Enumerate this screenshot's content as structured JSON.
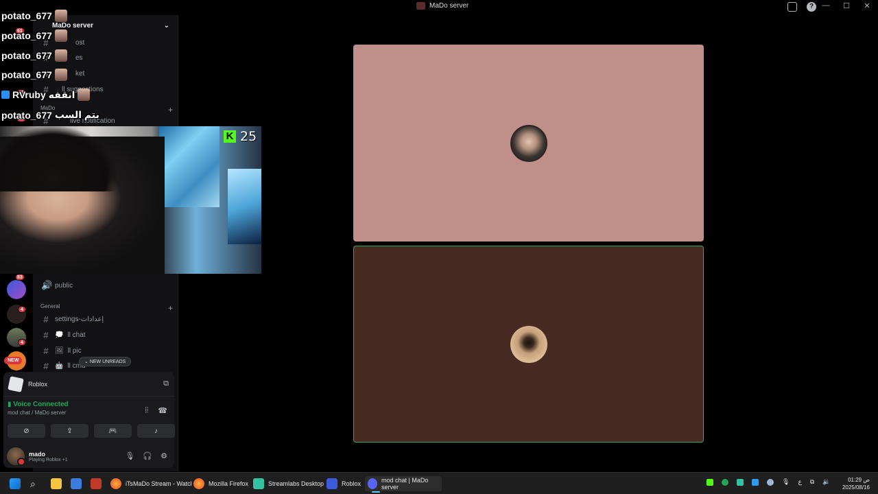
{
  "window": {
    "title": "MaDo server"
  },
  "server": {
    "name": "MaDo server"
  },
  "overlay_chat": [
    {
      "user": "potato_677"
    },
    {
      "user": "potato_677"
    },
    {
      "user": "potato_677"
    },
    {
      "user": "potato_677"
    },
    {
      "user": "RVruby",
      "message": "انقفه"
    },
    {
      "user": "potato_677",
      "message": "بتم السب"
    }
  ],
  "sidebar": {
    "channels_top": [
      {
        "label": "ost"
      },
      {
        "label": "es"
      },
      {
        "label": "ket"
      },
      {
        "label": "ll suggestions"
      }
    ],
    "category_mado": "MaDo",
    "live_notification": "live notification",
    "public_channel": "public",
    "category_general": "General",
    "channels_general": [
      {
        "label": "settings-إعدادات"
      },
      {
        "label": "ll chat"
      },
      {
        "label": "ll pic"
      },
      {
        "label": "ll cmd"
      }
    ],
    "new_unreads": "NEW UNREADS"
  },
  "guilds": {
    "badges": [
      "61",
      "81",
      "68",
      "83",
      "4",
      "4"
    ],
    "new_label": "NEW"
  },
  "webcam": {
    "kick_count": "25"
  },
  "voice_panel": {
    "activity": "Roblox",
    "status": "Voice Connected",
    "location": "mod chat / MaDo server"
  },
  "user": {
    "name": "mado",
    "status": "Playing Roblox +1"
  },
  "taskbar": {
    "items": [
      {
        "label": "iTsMaDo Stream - Watcl"
      },
      {
        "label": "Mozilla Firefox"
      },
      {
        "label": "Streamlabs Desktop"
      },
      {
        "label": "Roblox"
      },
      {
        "label": "mod chat | MaDo server"
      }
    ],
    "lang": "ع",
    "time": "01:29 ص",
    "date": "2025/08/16"
  },
  "colors": {
    "voice_connected": "#23a55a",
    "speaking_border": "#3ba55c",
    "tile1_bg": "#c08f89",
    "tile2_bg": "#472b22",
    "kick_green": "#53fc18"
  }
}
